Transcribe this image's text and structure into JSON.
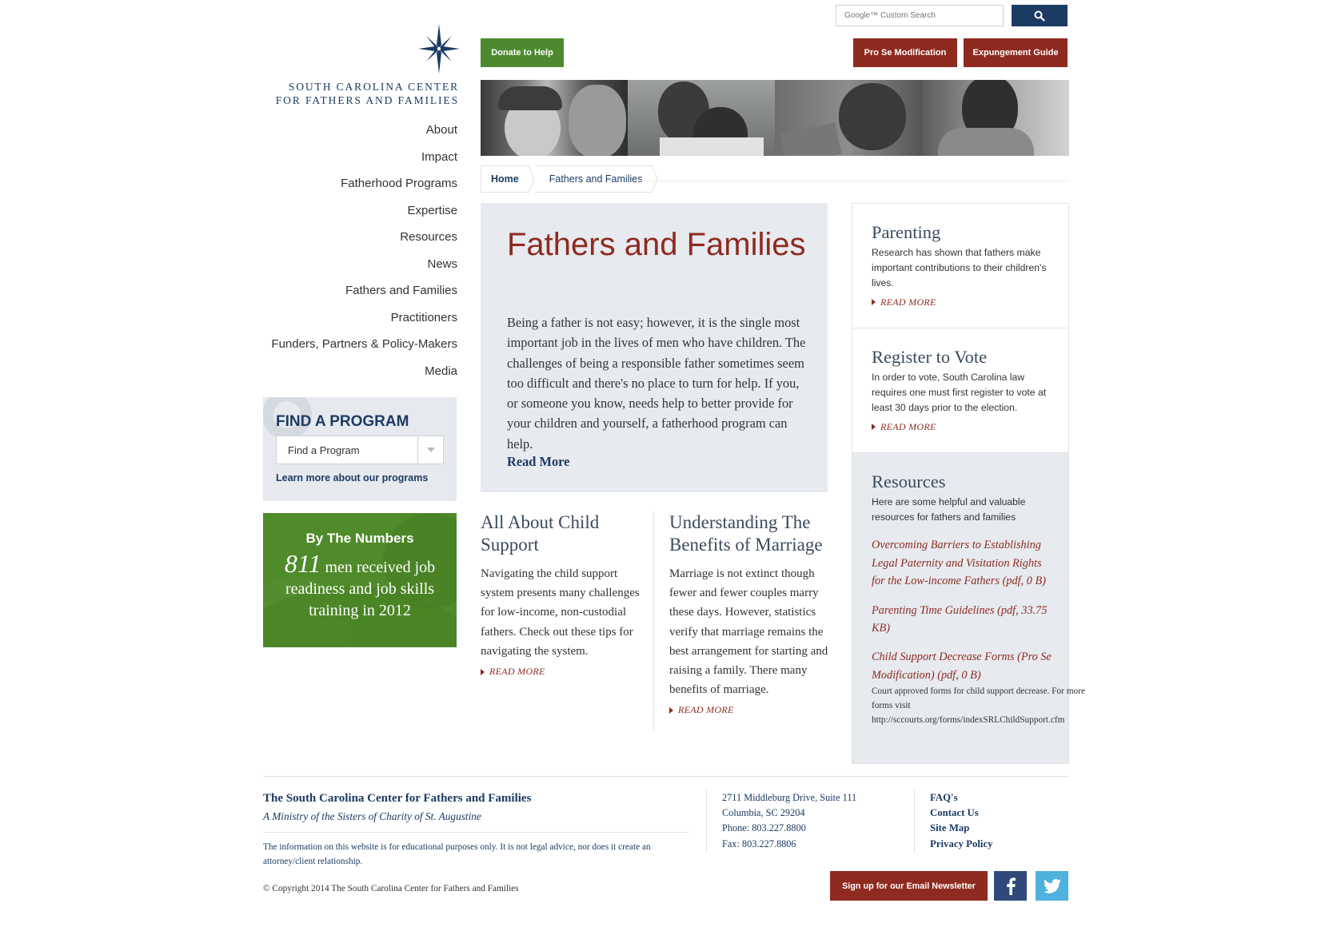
{
  "header": {
    "search_placeholder": "Google™ Custom Search",
    "donate_label": "Donate to Help",
    "prose_label": "Pro Se Modification",
    "expungement_label": "Expungement Guide"
  },
  "logo": {
    "line1": "SOUTH CAROLINA CENTER",
    "line2": "FOR FATHERS AND FAMILIES"
  },
  "nav": {
    "items": [
      {
        "label": "About"
      },
      {
        "label": "Impact"
      },
      {
        "label": "Fatherhood Programs"
      },
      {
        "label": "Expertise"
      },
      {
        "label": "Resources"
      },
      {
        "label": "News"
      },
      {
        "label": "Fathers and Families"
      },
      {
        "label": "Practitioners"
      },
      {
        "label": "Funders, Partners & Policy-Makers"
      },
      {
        "label": "Media"
      }
    ]
  },
  "find_program": {
    "title": "FIND A PROGRAM",
    "select_value": "Find a Program",
    "link": "Learn more about our programs"
  },
  "numbers": {
    "title": "By The Numbers",
    "value": "811",
    "text": "men received job readiness and job skills training in 2012"
  },
  "breadcrumb": {
    "home": "Home",
    "current": "Fathers and Families"
  },
  "hero": {
    "title": "Fathers and Families",
    "body": "Being a father is not easy; however, it is the single most important job in the lives of men who have children. The challenges of being a responsible father sometimes seem too difficult and there's no place to turn for help. If you, or someone you know, needs help to better provide for your children and yourself, a fatherhood program can help.",
    "read_more": "Read More"
  },
  "articles": [
    {
      "title": "All About Child Support",
      "body": "Navigating the child support system presents many challenges for low-income, non-custodial fathers. Check out these tips for navigating the system.",
      "read_more": "READ MORE"
    },
    {
      "title": "Understanding The Benefits of Marriage",
      "body": "Marriage is not extinct though fewer and fewer couples marry these days. However, statistics verify that marriage remains the best arrangement for starting and raising a family. There many benefits of marriage.",
      "read_more": "READ MORE"
    }
  ],
  "sidebar_right": {
    "parenting": {
      "title": "Parenting",
      "body": "Research has shown that fathers make important contributions to their children's lives.",
      "read_more": "READ MORE"
    },
    "vote": {
      "title": "Register to Vote",
      "body": "In order to vote, South Carolina law requires one must first register to vote at least 30 days prior to the election.",
      "read_more": "READ MORE"
    },
    "resources": {
      "title": "Resources",
      "body": "Here are some helpful and valuable resources for fathers and families",
      "links": [
        {
          "label": "Overcoming Barriers to Establishing Legal Paternity and Visitation Rights for the Low-income Fathers (pdf, 0 B)"
        },
        {
          "label": "Parenting Time Guidelines (pdf, 33.75 KB)"
        },
        {
          "label": "Child Support Decrease Forms (Pro Se Modification) (pdf, 0 B)"
        }
      ],
      "note": "Court approved forms for child support decrease. For more forms visit http://sccourts.org/forms/indexSRLChildSupport.cfm"
    }
  },
  "footer": {
    "org": "The South Carolina Center for Fathers and Families",
    "ministry": "A Ministry of the Sisters of Charity of St. Augustine",
    "disclaimer": "The information on this website is for educational purposes only. It is not legal advice, nor does it create an attorney/client relationship.",
    "copyright": "© Copyright 2014 The South Carolina Center for Fathers and Families",
    "address": [
      "2711 Middleburg Drive, Suite 111",
      "Columbia, SC 29204",
      "Phone: 803.227.8800",
      "Fax: 803.227.8806"
    ],
    "links": [
      {
        "label": "FAQ's"
      },
      {
        "label": "Contact Us"
      },
      {
        "label": "Site Map"
      },
      {
        "label": "Privacy Policy"
      }
    ],
    "newsletter_label": "Sign up for our Email Newsletter"
  },
  "colors": {
    "navy": "#1c3b63",
    "brick": "#8e2a1f",
    "green": "#4d8a2f",
    "panel": "#e7eaef"
  },
  "icons": {
    "search": "search-icon",
    "logo": "compass-star-icon",
    "dropdown": "chevron-down-icon",
    "facebook": "facebook-icon",
    "twitter": "twitter-icon"
  }
}
